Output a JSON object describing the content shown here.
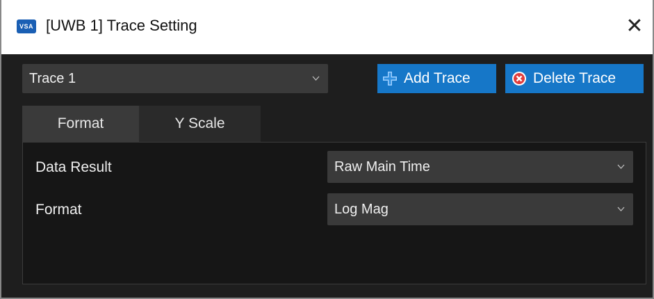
{
  "window": {
    "title": "[UWB 1] Trace Setting",
    "logo_text": "VSA",
    "close_glyph": "✕"
  },
  "trace_select": {
    "value": "Trace 1"
  },
  "buttons": {
    "add_trace": "Add Trace",
    "delete_trace": "Delete Trace"
  },
  "tabs": [
    {
      "label": "Format",
      "selected": true
    },
    {
      "label": "Y Scale",
      "selected": false
    }
  ],
  "format_panel": {
    "data_result": {
      "label": "Data Result",
      "value": "Raw Main Time"
    },
    "format": {
      "label": "Format",
      "value": "Log Mag"
    }
  },
  "colors": {
    "accent": "#1677c8",
    "background": "#1e1e1e",
    "control": "#3a3a3a",
    "delete_icon": "#e03c3c"
  },
  "icons": {
    "add": "plus-cross-icon",
    "delete": "circle-x-icon",
    "dropdown": "chevron-down-icon",
    "close": "close-icon"
  }
}
